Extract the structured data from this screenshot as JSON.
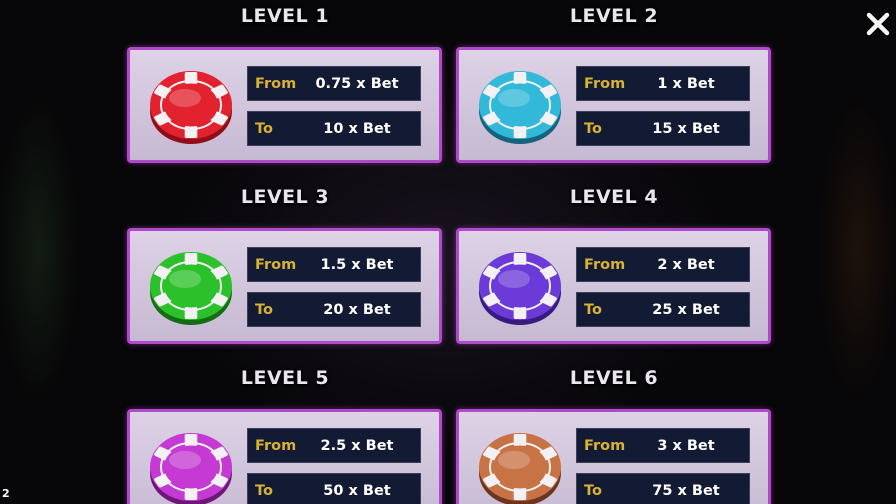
{
  "levels": [
    {
      "title": "LEVEL 1",
      "chip_color": "#e2222e",
      "chip_dark": "#8e0f18",
      "from_label": "From",
      "from_value": "0.75 x Bet",
      "to_label": "To",
      "to_value": "10 x Bet"
    },
    {
      "title": "LEVEL 2",
      "chip_color": "#32b9d9",
      "chip_dark": "#17637d",
      "from_label": "From",
      "from_value": "1 x Bet",
      "to_label": "To",
      "to_value": "15 x Bet"
    },
    {
      "title": "LEVEL 3",
      "chip_color": "#2cc12b",
      "chip_dark": "#136d14",
      "from_label": "From",
      "from_value": "1.5 x Bet",
      "to_label": "To",
      "to_value": "20 x Bet"
    },
    {
      "title": "LEVEL 4",
      "chip_color": "#6b3ad8",
      "chip_dark": "#371b7d",
      "from_label": "From",
      "from_value": "2 x Bet",
      "to_label": "To",
      "to_value": "25 x Bet"
    },
    {
      "title": "LEVEL 5",
      "chip_color": "#c43ad3",
      "chip_dark": "#6e1777",
      "from_label": "From",
      "from_value": "2.5 x Bet",
      "to_label": "To",
      "to_value": "50 x Bet"
    },
    {
      "title": "LEVEL 6",
      "chip_color": "#c87346",
      "chip_dark": "#6d3520",
      "from_label": "From",
      "from_value": "3 x Bet",
      "to_label": "To",
      "to_value": "75 x Bet"
    }
  ],
  "corner_number": "2",
  "icons": {
    "close": "close-icon",
    "chip": "poker-chip-icon"
  }
}
